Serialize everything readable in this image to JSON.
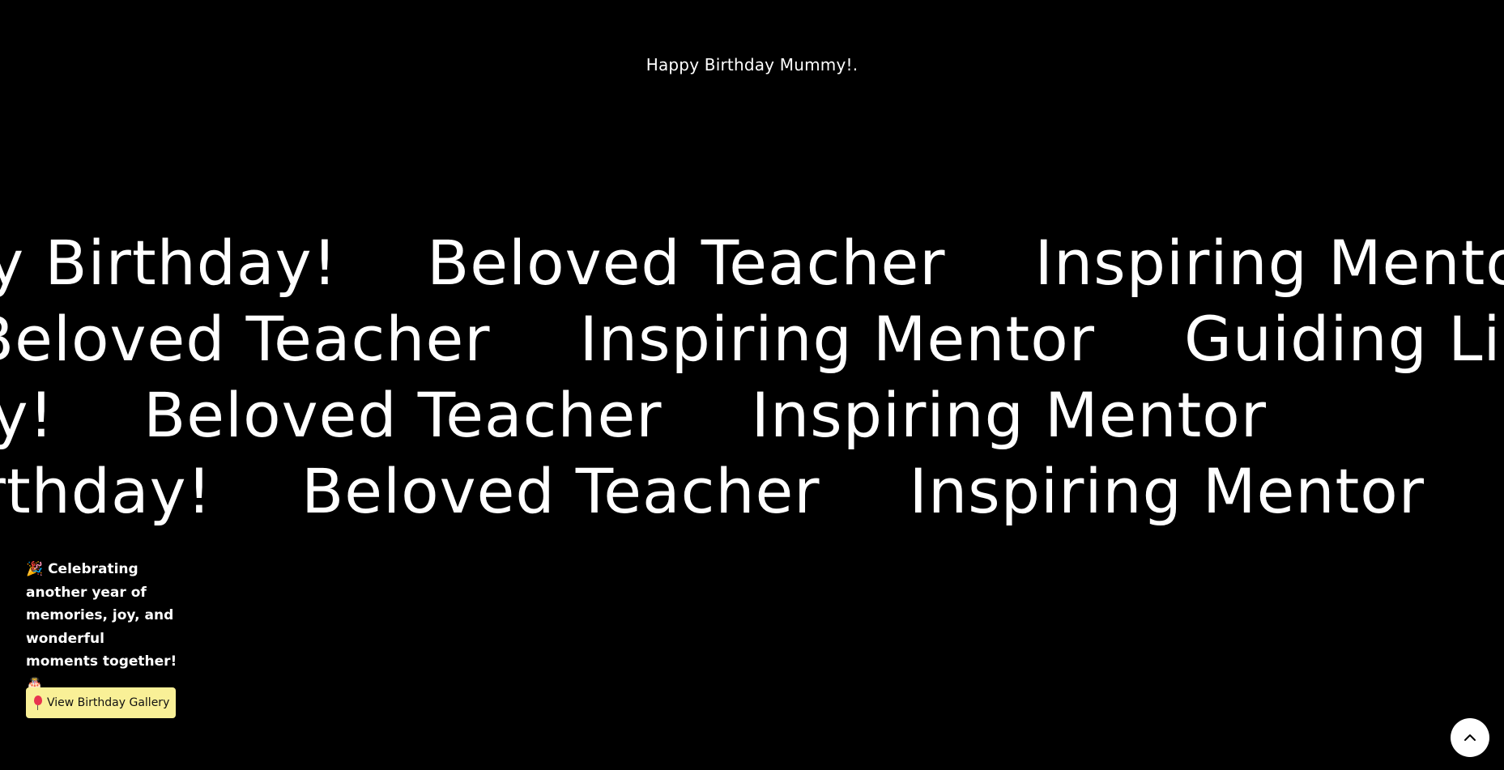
{
  "header": {
    "title": "Happy Birthday Mummy!."
  },
  "marquee": {
    "rows": [
      {
        "words": [
          "Happy Birthday!",
          "Beloved Teacher",
          "Inspiring Mentor"
        ]
      },
      {
        "words": [
          "Beloved Teacher",
          "Inspiring Mentor",
          "Guiding Light"
        ]
      },
      {
        "words": [
          "Happy Birthday!",
          "Beloved Teacher",
          "Inspiring Mentor"
        ]
      },
      {
        "words": [
          "Happy Birthday!",
          "Beloved Teacher",
          "Inspiring Mentor"
        ]
      }
    ]
  },
  "hero": {
    "tagline": "🎉 Celebrating another year of memories, joy, and wonderful moments together! 🎂",
    "gallery_button_label": "View Birthday Gallery"
  },
  "icons": {
    "gallery_button_icon": "balloon-icon",
    "scroll_top_icon": "chevron-up-icon"
  },
  "colors": {
    "background": "#000000",
    "text": "#ffffff",
    "button_accent": "#f9f097"
  }
}
